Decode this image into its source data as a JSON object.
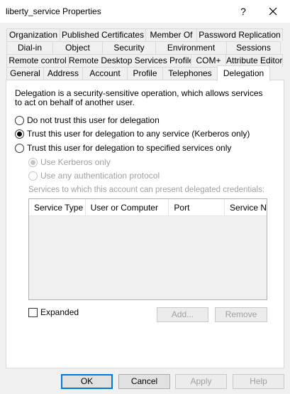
{
  "window": {
    "title": "liberty_service Properties",
    "help_glyph": "?"
  },
  "tabs": {
    "row1": [
      "Organization",
      "Published Certificates",
      "Member Of",
      "Password Replication"
    ],
    "row2": [
      "Dial-in",
      "Object",
      "Security",
      "Environment",
      "Sessions"
    ],
    "row3": [
      "Remote control",
      "Remote Desktop Services Profile",
      "COM+",
      "Attribute Editor"
    ],
    "row4": [
      "General",
      "Address",
      "Account",
      "Profile",
      "Telephones",
      "Delegation"
    ],
    "active": "Delegation"
  },
  "delegation": {
    "description": "Delegation is a security-sensitive operation, which allows services to act on behalf of another user.",
    "options": [
      {
        "label": "Do not trust this user for delegation",
        "checked": false
      },
      {
        "label": "Trust this user for delegation to any service (Kerberos only)",
        "checked": true
      },
      {
        "label": "Trust this user for delegation to specified services only",
        "checked": false
      }
    ],
    "sub_options": [
      {
        "label": "Use Kerberos only",
        "checked": true,
        "enabled": false
      },
      {
        "label": "Use any authentication protocol",
        "checked": false,
        "enabled": false
      }
    ],
    "services_label": "Services to which this account can present delegated credentials:",
    "columns": [
      "Service Type",
      "User or Computer",
      "Port",
      "Service Na"
    ],
    "expanded_label": "Expanded",
    "add_label": "Add...",
    "remove_label": "Remove"
  },
  "footer": {
    "ok": "OK",
    "cancel": "Cancel",
    "apply": "Apply",
    "help": "Help"
  },
  "colors": {
    "accent": "#0078d7",
    "disabled_text": "#a0a0a0"
  }
}
